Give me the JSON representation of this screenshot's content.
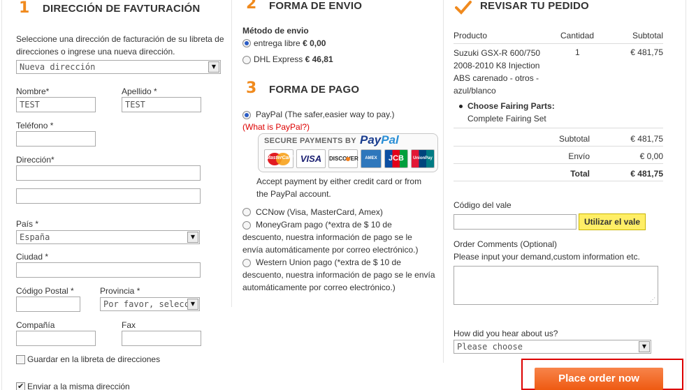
{
  "billing": {
    "step_number": "1",
    "title": "DIRECCIÓN DE FAVTURACIÓN",
    "intro": "Seleccione una dirección de facturación de su libreta de direcciones o ingrese una nueva dirección.",
    "address_select": "Nueva dirección",
    "nombre_label": "Nombre*",
    "nombre_value": "TEST",
    "apellido_label": "Apellido *",
    "apellido_value": "TEST",
    "telefono_label": "Teléfono *",
    "direccion_label": "Dirección*",
    "pais_label": "País *",
    "pais_value": "España",
    "ciudad_label": "Ciudad *",
    "codigo_postal_label": "Código Postal *",
    "provincia_label": "Provincia *",
    "provincia_value": "Por favor, selecci",
    "compania_label": "Compañía",
    "fax_label": "Fax",
    "save_address_label": "Guardar en la libreta de direcciones",
    "same_address_label": "Enviar a la misma dirección"
  },
  "shipping": {
    "step_number": "2",
    "title": "FORMA DE ENVIO",
    "method_label": "Método de envio",
    "options": [
      {
        "label": "entrega libre",
        "price": "€ 0,00",
        "selected": true
      },
      {
        "label": "DHL Express",
        "price": "€ 46,81",
        "selected": false
      }
    ]
  },
  "payment": {
    "step_number": "3",
    "title": "FORMA DE PAGO",
    "paypal_label": "PayPal (The safer,easier way to pay.)",
    "paypal_link": "(What is PayPal?)",
    "secure_text": "SECURE PAYMENTS BY",
    "paypal_brand_1": "Pay",
    "paypal_brand_2": "Pal",
    "cards": [
      "MasterCard",
      "VISA",
      "DISCOVER",
      "AMEX",
      "JCB",
      "UnionPay"
    ],
    "paypal_desc": "Accept payment by either credit card or from the PayPal account.",
    "ccnow_label": "CCNow (Visa, MasterCard, Amex)",
    "moneygram_label": "MoneyGram pago (*extra de $ 10 de descuento, nuestra información de pago se le envía automáticamente por correo electrónico.)",
    "western_label": "Western Union pago (*extra de $ 10 de descuento, nuestra información de pago se le envía automáticamente por correo electrónico.)"
  },
  "review": {
    "title": "REVISAR TU PEDIDO",
    "col_product": "Producto",
    "col_qty": "Cantidad",
    "col_subtotal": "Subtotal",
    "item_name": "Suzuki GSX-R 600/750 2008-2010 K8 Injection ABS carenado - otros - azul/blanco",
    "item_qty": "1",
    "item_price": "€ 481,75",
    "option_label": "Choose Fairing Parts:",
    "option_value": "Complete Fairing Set",
    "subtotal_label": "Subtotal",
    "subtotal_value": "€ 481,75",
    "envio_label": "Envío",
    "envio_value": "€ 0,00",
    "total_label": "Total",
    "total_value": "€ 481,75",
    "voucher_label": "Código del vale",
    "voucher_button": "Utilizar el vale",
    "comments_label": "Order Comments (Optional)",
    "comments_hint": "Please input your demand,custom information etc.",
    "hear_label": "How did you hear about us?",
    "hear_select": "Please choose",
    "place_order": "Place order now"
  },
  "colors": {
    "accent": "#f08a1e",
    "order_button": "#f26a1b",
    "voucher_button": "#ffee66",
    "highlight_border": "#dd0000"
  }
}
